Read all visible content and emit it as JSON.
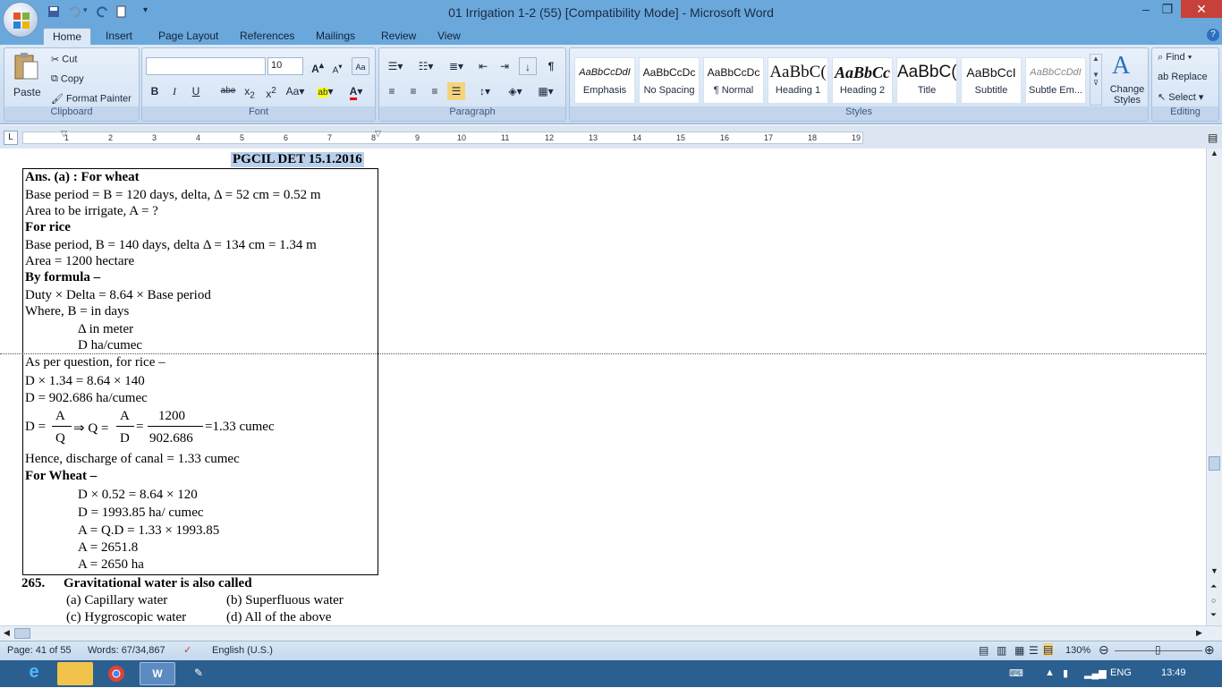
{
  "window": {
    "title": "01 Irrigation 1-2 (55) [Compatibility Mode] - Microsoft Word",
    "controls": {
      "minimize": "–",
      "restore": "❐",
      "close": "✕"
    }
  },
  "tabs": [
    "Home",
    "Insert",
    "Page Layout",
    "References",
    "Mailings",
    "Review",
    "View"
  ],
  "active_tab": "Home",
  "ribbon": {
    "clipboard": {
      "label": "Clipboard",
      "paste": "Paste",
      "cut": "Cut",
      "copy": "Copy",
      "format_painter": "Format Painter"
    },
    "font": {
      "label": "Font",
      "font_name": "",
      "font_size": "10"
    },
    "paragraph": {
      "label": "Paragraph"
    },
    "styles": {
      "label": "Styles",
      "tiles": [
        {
          "sample": "AaBbCcDdI",
          "name": "Emphasis"
        },
        {
          "sample": "AaBbCcDc",
          "name": "No Spacing"
        },
        {
          "sample": "AaBbCcDc",
          "name": "¶ Normal"
        },
        {
          "sample": "AaBbC(",
          "name": "Heading 1"
        },
        {
          "sample": "AaBbCc",
          "name": "Heading 2"
        },
        {
          "sample": "AaBbC(",
          "name": "Title"
        },
        {
          "sample": "AaBbCcI",
          "name": "Subtitle"
        },
        {
          "sample": "AaBbCcDdI",
          "name": "Subtle Em..."
        }
      ],
      "change_styles": "Change Styles"
    },
    "editing": {
      "label": "Editing",
      "find": "Find",
      "replace": "Replace",
      "select": "Select"
    }
  },
  "ruler": {
    "numbers": [
      "1",
      "2",
      "3",
      "4",
      "5",
      "6",
      "7",
      "8",
      "9",
      "10",
      "11",
      "12",
      "13",
      "14",
      "15",
      "16",
      "17",
      "18",
      "19"
    ]
  },
  "document": {
    "header": "PGCIL DET 15.1.2016",
    "lines": [
      "Ans. (a) : For wheat",
      "Base period = B = 120 days, delta, Δ = 52 cm = 0.52 m",
      "Area to be irrigate, A = ?",
      "For rice",
      "Base period, B = 140 days, delta Δ = 134 cm = 1.34 m",
      "Area = 1200 hectare",
      "By formula –",
      "Duty × Delta = 8.64 × Base period",
      "Where, B = in days",
      "Δ in meter",
      "D ha/cumec",
      "As per question, for rice –",
      "D × 1.34 = 8.64 × 140",
      "D = 902.686   ha/cumec"
    ],
    "formula": {
      "lhs": "D =",
      "f1_num": "A",
      "f1_den": "Q",
      "arrow": "⇒ Q =",
      "f2_num": "A",
      "f2_den": "D",
      "eq": "=",
      "f3_num": "1200",
      "f3_den": "902.686",
      "result": "=1.33 cumec"
    },
    "lines2": [
      "Hence, discharge of canal = 1.33 cumec",
      "For Wheat –",
      "D × 0.52 = 8.64 × 120",
      "D = 1993.85 ha/ cumec",
      "A = Q.D = 1.33 × 1993.85",
      "A = 2651.8",
      "A = 2650 ha"
    ],
    "question": {
      "number": "265.",
      "text": "Gravitational water is also called",
      "options": [
        "(a)  Capillary water",
        "(b)  Superfluous water",
        "(c)  Hygroscopic water",
        "(d)  All of the above"
      ]
    }
  },
  "status": {
    "page": "Page: 41 of 55",
    "words": "Words: 67/34,867",
    "language": "English (U.S.)",
    "zoom": "130%"
  },
  "taskbar": {
    "lang": "ENG",
    "time": "13:49"
  }
}
